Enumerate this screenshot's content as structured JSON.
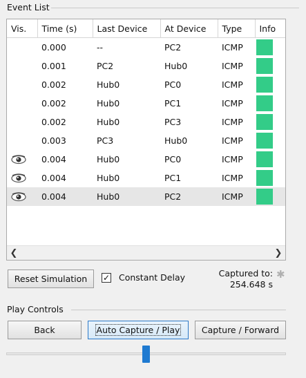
{
  "event_list": {
    "title": "Event List",
    "columns": [
      "Vis.",
      "Time (s)",
      "Last Device",
      "At Device",
      "Type",
      "Info"
    ],
    "rows": [
      {
        "visible": false,
        "time": "0.000",
        "last": "--",
        "at": "PC2",
        "type": "ICMP",
        "info_color": "#33cc88",
        "selected": false
      },
      {
        "visible": false,
        "time": "0.001",
        "last": "PC2",
        "at": "Hub0",
        "type": "ICMP",
        "info_color": "#33cc88",
        "selected": false
      },
      {
        "visible": false,
        "time": "0.002",
        "last": "Hub0",
        "at": "PC0",
        "type": "ICMP",
        "info_color": "#33cc88",
        "selected": false
      },
      {
        "visible": false,
        "time": "0.002",
        "last": "Hub0",
        "at": "PC1",
        "type": "ICMP",
        "info_color": "#33cc88",
        "selected": false
      },
      {
        "visible": false,
        "time": "0.002",
        "last": "Hub0",
        "at": "PC3",
        "type": "ICMP",
        "info_color": "#33cc88",
        "selected": false
      },
      {
        "visible": false,
        "time": "0.003",
        "last": "PC3",
        "at": "Hub0",
        "type": "ICMP",
        "info_color": "#33cc88",
        "selected": false
      },
      {
        "visible": true,
        "time": "0.004",
        "last": "Hub0",
        "at": "PC0",
        "type": "ICMP",
        "info_color": "#33cc88",
        "selected": false
      },
      {
        "visible": true,
        "time": "0.004",
        "last": "Hub0",
        "at": "PC1",
        "type": "ICMP",
        "info_color": "#33cc88",
        "selected": false
      },
      {
        "visible": true,
        "time": "0.004",
        "last": "Hub0",
        "at": "PC2",
        "type": "ICMP",
        "info_color": "#33cc88",
        "selected": true
      }
    ],
    "scroll_left_icon": "chevron-left-icon",
    "scroll_right_icon": "chevron-right-icon"
  },
  "controls": {
    "reset_label": "Reset Simulation",
    "constant_delay_label": "Constant Delay",
    "constant_delay_checked": true,
    "captured_label": "Captured to:",
    "captured_value": "254.648 s"
  },
  "play_controls": {
    "title": "Play Controls",
    "back_label": "Back",
    "auto_label": "Auto Capture / Play",
    "forward_label": "Capture / Forward",
    "speed_fraction": 0.5
  }
}
